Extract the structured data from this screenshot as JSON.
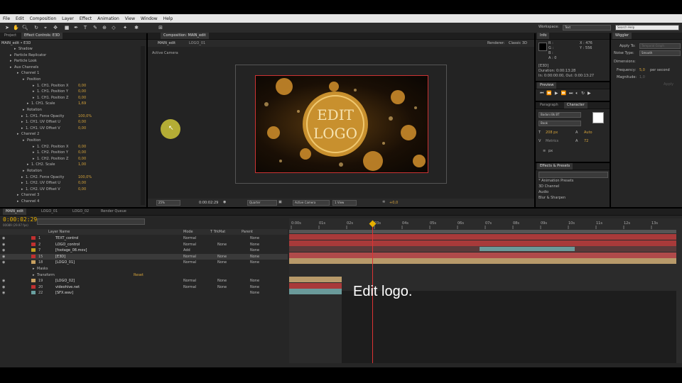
{
  "menu": [
    "File",
    "Edit",
    "Composition",
    "Layer",
    "Effect",
    "Animation",
    "View",
    "Window",
    "Help"
  ],
  "toolbar": {
    "workspace_label": "Workspace:",
    "workspace_value": "Text",
    "search_placeholder": "Search Help"
  },
  "project_panel": {
    "tabs": [
      "Project",
      "Effect Controls: E3D"
    ],
    "header": "MAIN_edit • E3D",
    "rows": [
      {
        "indent": 26,
        "text": "Shadow",
        "val": ""
      },
      {
        "indent": 20,
        "text": "Particle Replicator",
        "val": ""
      },
      {
        "indent": 20,
        "text": "Particle Look",
        "val": ""
      },
      {
        "indent": 20,
        "text": "Aux Channels",
        "val": ""
      },
      {
        "indent": 30,
        "text": "Channel 1",
        "val": ""
      },
      {
        "indent": 38,
        "text": "Position",
        "val": ""
      },
      {
        "indent": 52,
        "text": "1. CH1. Position X",
        "val": "0,00"
      },
      {
        "indent": 52,
        "text": "1. CH1. Position Y",
        "val": "0,00"
      },
      {
        "indent": 52,
        "text": "1. CH1. Position Z",
        "val": "0,00"
      },
      {
        "indent": 44,
        "text": "1. CH1. Scale",
        "val": "1,69"
      },
      {
        "indent": 38,
        "text": "Rotation",
        "val": ""
      },
      {
        "indent": 36,
        "text": "1. CH1. Force Opacity",
        "val": "100,0%"
      },
      {
        "indent": 36,
        "text": "1. CH1. UV Offset U",
        "val": "0,00"
      },
      {
        "indent": 36,
        "text": "1. CH1. UV Offset V",
        "val": "0,00"
      },
      {
        "indent": 30,
        "text": "Channel 2",
        "val": ""
      },
      {
        "indent": 38,
        "text": "Position",
        "val": ""
      },
      {
        "indent": 52,
        "text": "1. CH2. Position X",
        "val": "0,00"
      },
      {
        "indent": 52,
        "text": "1. CH2. Position Y",
        "val": "0,00"
      },
      {
        "indent": 52,
        "text": "1. CH2. Position Z",
        "val": "0,00"
      },
      {
        "indent": 44,
        "text": "1. CH2. Scale",
        "val": "1,00"
      },
      {
        "indent": 38,
        "text": "Rotation",
        "val": ""
      },
      {
        "indent": 36,
        "text": "1. CH2. Force Opacity",
        "val": "100,0%"
      },
      {
        "indent": 36,
        "text": "1. CH2. UV Offset U",
        "val": "0,00"
      },
      {
        "indent": 36,
        "text": "1. CH2. UV Offset V",
        "val": "0,00"
      },
      {
        "indent": 30,
        "text": "Channel 3",
        "val": ""
      },
      {
        "indent": 30,
        "text": "Channel 4",
        "val": ""
      }
    ]
  },
  "comp_panel": {
    "tab": "Composition: MAIN_edit",
    "breadcrumbs": [
      "MAIN_edit",
      "LOGO_01"
    ],
    "renderer_label": "Renderer:",
    "renderer_value": "Classic 3D",
    "camera_label": "Active Camera",
    "logo_line1": "EDIT",
    "logo_line2": "LOGO",
    "footer": {
      "zoom": "25%",
      "timecode": "0:00:02:29",
      "resolution": "Quarter",
      "camera": "Active Camera",
      "view": "1 View",
      "exposure": "+0,0"
    }
  },
  "info_panel": {
    "tab": "Info",
    "r": "R :",
    "g": "G :",
    "b": "B :",
    "a": "A : 0",
    "x": "X : 476",
    "y": "Y : 556",
    "name": "[E3D]",
    "duration": "Duration: 0:00:13:28",
    "in_out": "In: 0:00:00:00, Out: 0:00:13:27"
  },
  "preview_panel": {
    "tab": "Preview"
  },
  "character_panel": {
    "tabs": [
      "Paragraph",
      "Character"
    ],
    "font": "Bodoni Bk BT",
    "style": "Book",
    "size": "208 px",
    "leading": "Auto",
    "kerning": "Metrics",
    "tracking": "72",
    "unit": "px"
  },
  "effects_panel": {
    "tab": "Effects & Presets",
    "items": [
      "* Animation Presets",
      "3D Channel",
      "Audio",
      "Blur & Sharpen"
    ]
  },
  "wiggler_panel": {
    "tab": "Wiggler",
    "apply_to_label": "Apply To:",
    "apply_to_value": "Temporal Graph",
    "noise_label": "Noise Type:",
    "noise_value": "Smooth",
    "dimensions_label": "Dimensions:",
    "frequency_label": "Frequency:",
    "frequency_value": "5,0",
    "frequency_unit": "per second",
    "magnitude_label": "Magnitude:",
    "magnitude_value": "1,0",
    "apply_button": "Apply"
  },
  "timeline": {
    "tabs": [
      "MAIN_edit",
      "LOGO_01",
      "LOGO_02",
      "Render Queue"
    ],
    "timecode": "0:00:02:29",
    "fps": "00089 (29.97 fps)",
    "col_layer_name": "Layer Name",
    "col_mode": "Mode",
    "col_trkmat": "T TrkMat",
    "col_parent": "Parent",
    "ruler": [
      "0:00s",
      "01s",
      "02s",
      "03s",
      "04s",
      "05s",
      "06s",
      "07s",
      "08s",
      "09s",
      "10s",
      "11s",
      "12s",
      "13s"
    ],
    "layers": [
      {
        "num": "1",
        "name": "TEXT_control",
        "mode": "Normal",
        "trkmat": "",
        "parent": "None",
        "color": "#c03030"
      },
      {
        "num": "2",
        "name": "LOGO_control",
        "mode": "Normal",
        "trkmat": "None",
        "parent": "None",
        "color": "#c03030"
      },
      {
        "num": "7",
        "name": "[footage_08.mov]",
        "mode": "Add",
        "trkmat": "",
        "parent": "None",
        "color": "#c0a020"
      },
      {
        "num": "15",
        "name": "[E3D]",
        "mode": "Normal",
        "trkmat": "None",
        "parent": "None",
        "color": "#c03030"
      },
      {
        "num": "18",
        "name": "[LOGO_01]",
        "mode": "Normal",
        "trkmat": "None",
        "parent": "None",
        "color": "#c8a060"
      },
      {
        "num": "",
        "name": "Masks",
        "mode": "",
        "trkmat": "",
        "parent": "",
        "color": ""
      },
      {
        "num": "",
        "name": "Transform",
        "mode": "",
        "trkmat": "",
        "parent": "",
        "color": ""
      },
      {
        "num": "19",
        "name": "[LOGO_02]",
        "mode": "Normal",
        "trkmat": "None",
        "parent": "None",
        "color": "#c8a060"
      },
      {
        "num": "20",
        "name": "videohive.net",
        "mode": "Normal",
        "trkmat": "None",
        "parent": "None",
        "color": "#c03030"
      },
      {
        "num": "22",
        "name": "[SFX.wav]",
        "mode": "",
        "trkmat": "",
        "parent": "None",
        "color": "#6aa0a0"
      }
    ],
    "reset_label": "Reset"
  },
  "caption": "Edit logo.",
  "colors": {
    "accent": "#d6a33a",
    "timecode": "#e8b000",
    "bar_red": "#a83a3a",
    "bar_tan": "#b89a6a",
    "bar_teal": "#6a9a9a"
  }
}
